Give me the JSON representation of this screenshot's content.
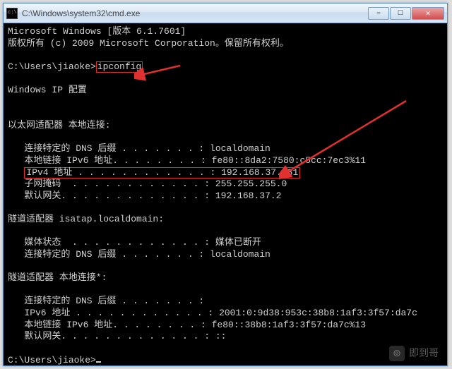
{
  "window": {
    "title": "C:\\Windows\\system32\\cmd.exe"
  },
  "header": {
    "line1": "Microsoft Windows [版本 6.1.7601]",
    "line2": "版权所有 (c) 2009 Microsoft Corporation。保留所有权利。"
  },
  "prompt": {
    "path": "C:\\Users\\jiaoke>",
    "command": "ipconfig"
  },
  "ipconfig_heading": "Windows IP 配置",
  "adapters": [
    {
      "title": "以太网适配器 本地连接:",
      "rows": [
        {
          "label": "连接特定的 DNS 后缀 . . . . . . . :",
          "value": "localdomain"
        },
        {
          "label": "本地链接 IPv6 地址. . . . . . . . :",
          "value": "fe80::8da2:7580:c5cc:7ec3%11"
        },
        {
          "label": "IPv4 地址 . . . . . . . . . . . . :",
          "value": "192.168.37.131",
          "highlight": true
        },
        {
          "label": "子网掩码  . . . . . . . . . . . . :",
          "value": "255.255.255.0"
        },
        {
          "label": "默认网关. . . . . . . . . . . . . :",
          "value": "192.168.37.2"
        }
      ]
    },
    {
      "title": "隧道适配器 isatap.localdomain:",
      "rows": [
        {
          "label": "媒体状态  . . . . . . . . . . . . :",
          "value": "媒体已断开"
        },
        {
          "label": "连接特定的 DNS 后缀 . . . . . . . :",
          "value": "localdomain"
        }
      ]
    },
    {
      "title": "隧道适配器 本地连接*:",
      "rows": [
        {
          "label": "连接特定的 DNS 后缀 . . . . . . . :",
          "value": ""
        },
        {
          "label": "IPv6 地址 . . . . . . . . . . . . :",
          "value": "2001:0:9d38:953c:38b8:1af3:3f57:da7c"
        },
        {
          "label": "本地链接 IPv6 地址. . . . . . . . :",
          "value": "fe80::38b8:1af3:3f57:da7c%13"
        },
        {
          "label": "默认网关. . . . . . . . . . . . . :",
          "value": "::"
        }
      ]
    }
  ],
  "final_prompt": "C:\\Users\\jiaoke>",
  "annotations": {
    "highlight_color": "#e03030"
  },
  "watermark": {
    "text": "即到哥"
  }
}
